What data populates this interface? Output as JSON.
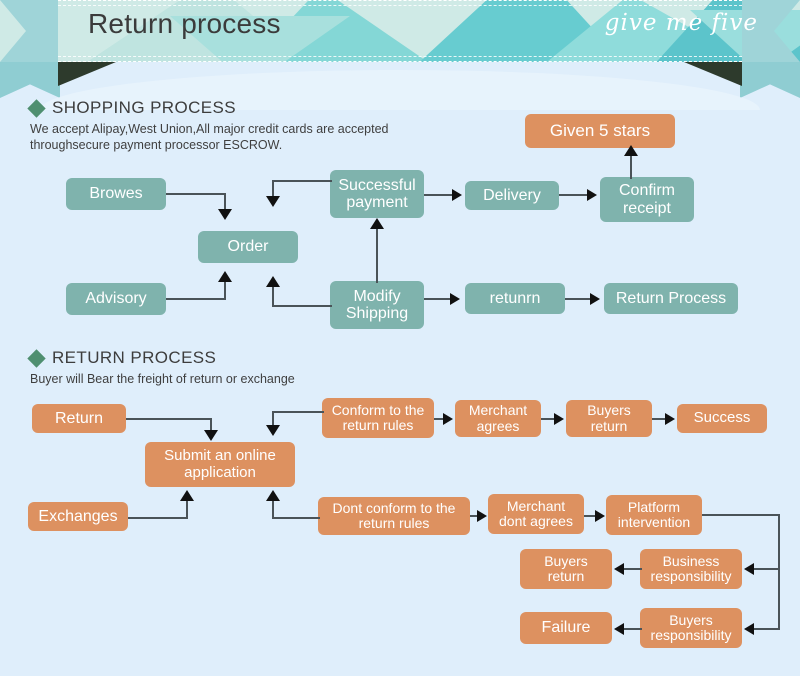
{
  "banner": {
    "title": "Return process",
    "script": "give me five"
  },
  "shopping": {
    "heading": "SHOPPING PROCESS",
    "description": "We accept Alipay,West Union,All major credit cards are accepted\nthroughsecure payment processor ESCROW.",
    "nodes": {
      "browes": "Browes",
      "order": "Order",
      "advisory": "Advisory",
      "successful_payment": "Successful\npayment",
      "modify_shipping": "Modify\nShipping",
      "delivery": "Delivery",
      "confirm_receipt": "Confirm\nreceipt",
      "given_5_stars": "Given 5 stars",
      "retunrn": "retunrn",
      "return_process": "Return Process"
    }
  },
  "returns": {
    "heading": "RETURN PROCESS",
    "description": "Buyer will Bear the freight of return or exchange",
    "nodes": {
      "return": "Return",
      "exchanges": "Exchanges",
      "submit_application": "Submit an online\napplication",
      "conform_rules": "Conform to the\nreturn rules",
      "merchant_agrees": "Merchant\nagrees",
      "buyers_return_top": "Buyers\nreturn",
      "success": "Success",
      "dont_conform_rules": "Dont conform to the\nreturn rules",
      "merchant_dont_agrees": "Merchant\ndont agrees",
      "platform_intervention": "Platform\nintervention",
      "business_responsibility": "Business\nresponsibility",
      "buyers_return_mid": "Buyers\nreturn",
      "buyers_responsibility": "Buyers\nresponsibility",
      "failure": "Failure"
    }
  },
  "colors": {
    "teal": "#7FB3AD",
    "orange": "#DD9160",
    "background": "#DFEEFB",
    "diamond": "#4F8F70",
    "connector": "#4A5358"
  }
}
